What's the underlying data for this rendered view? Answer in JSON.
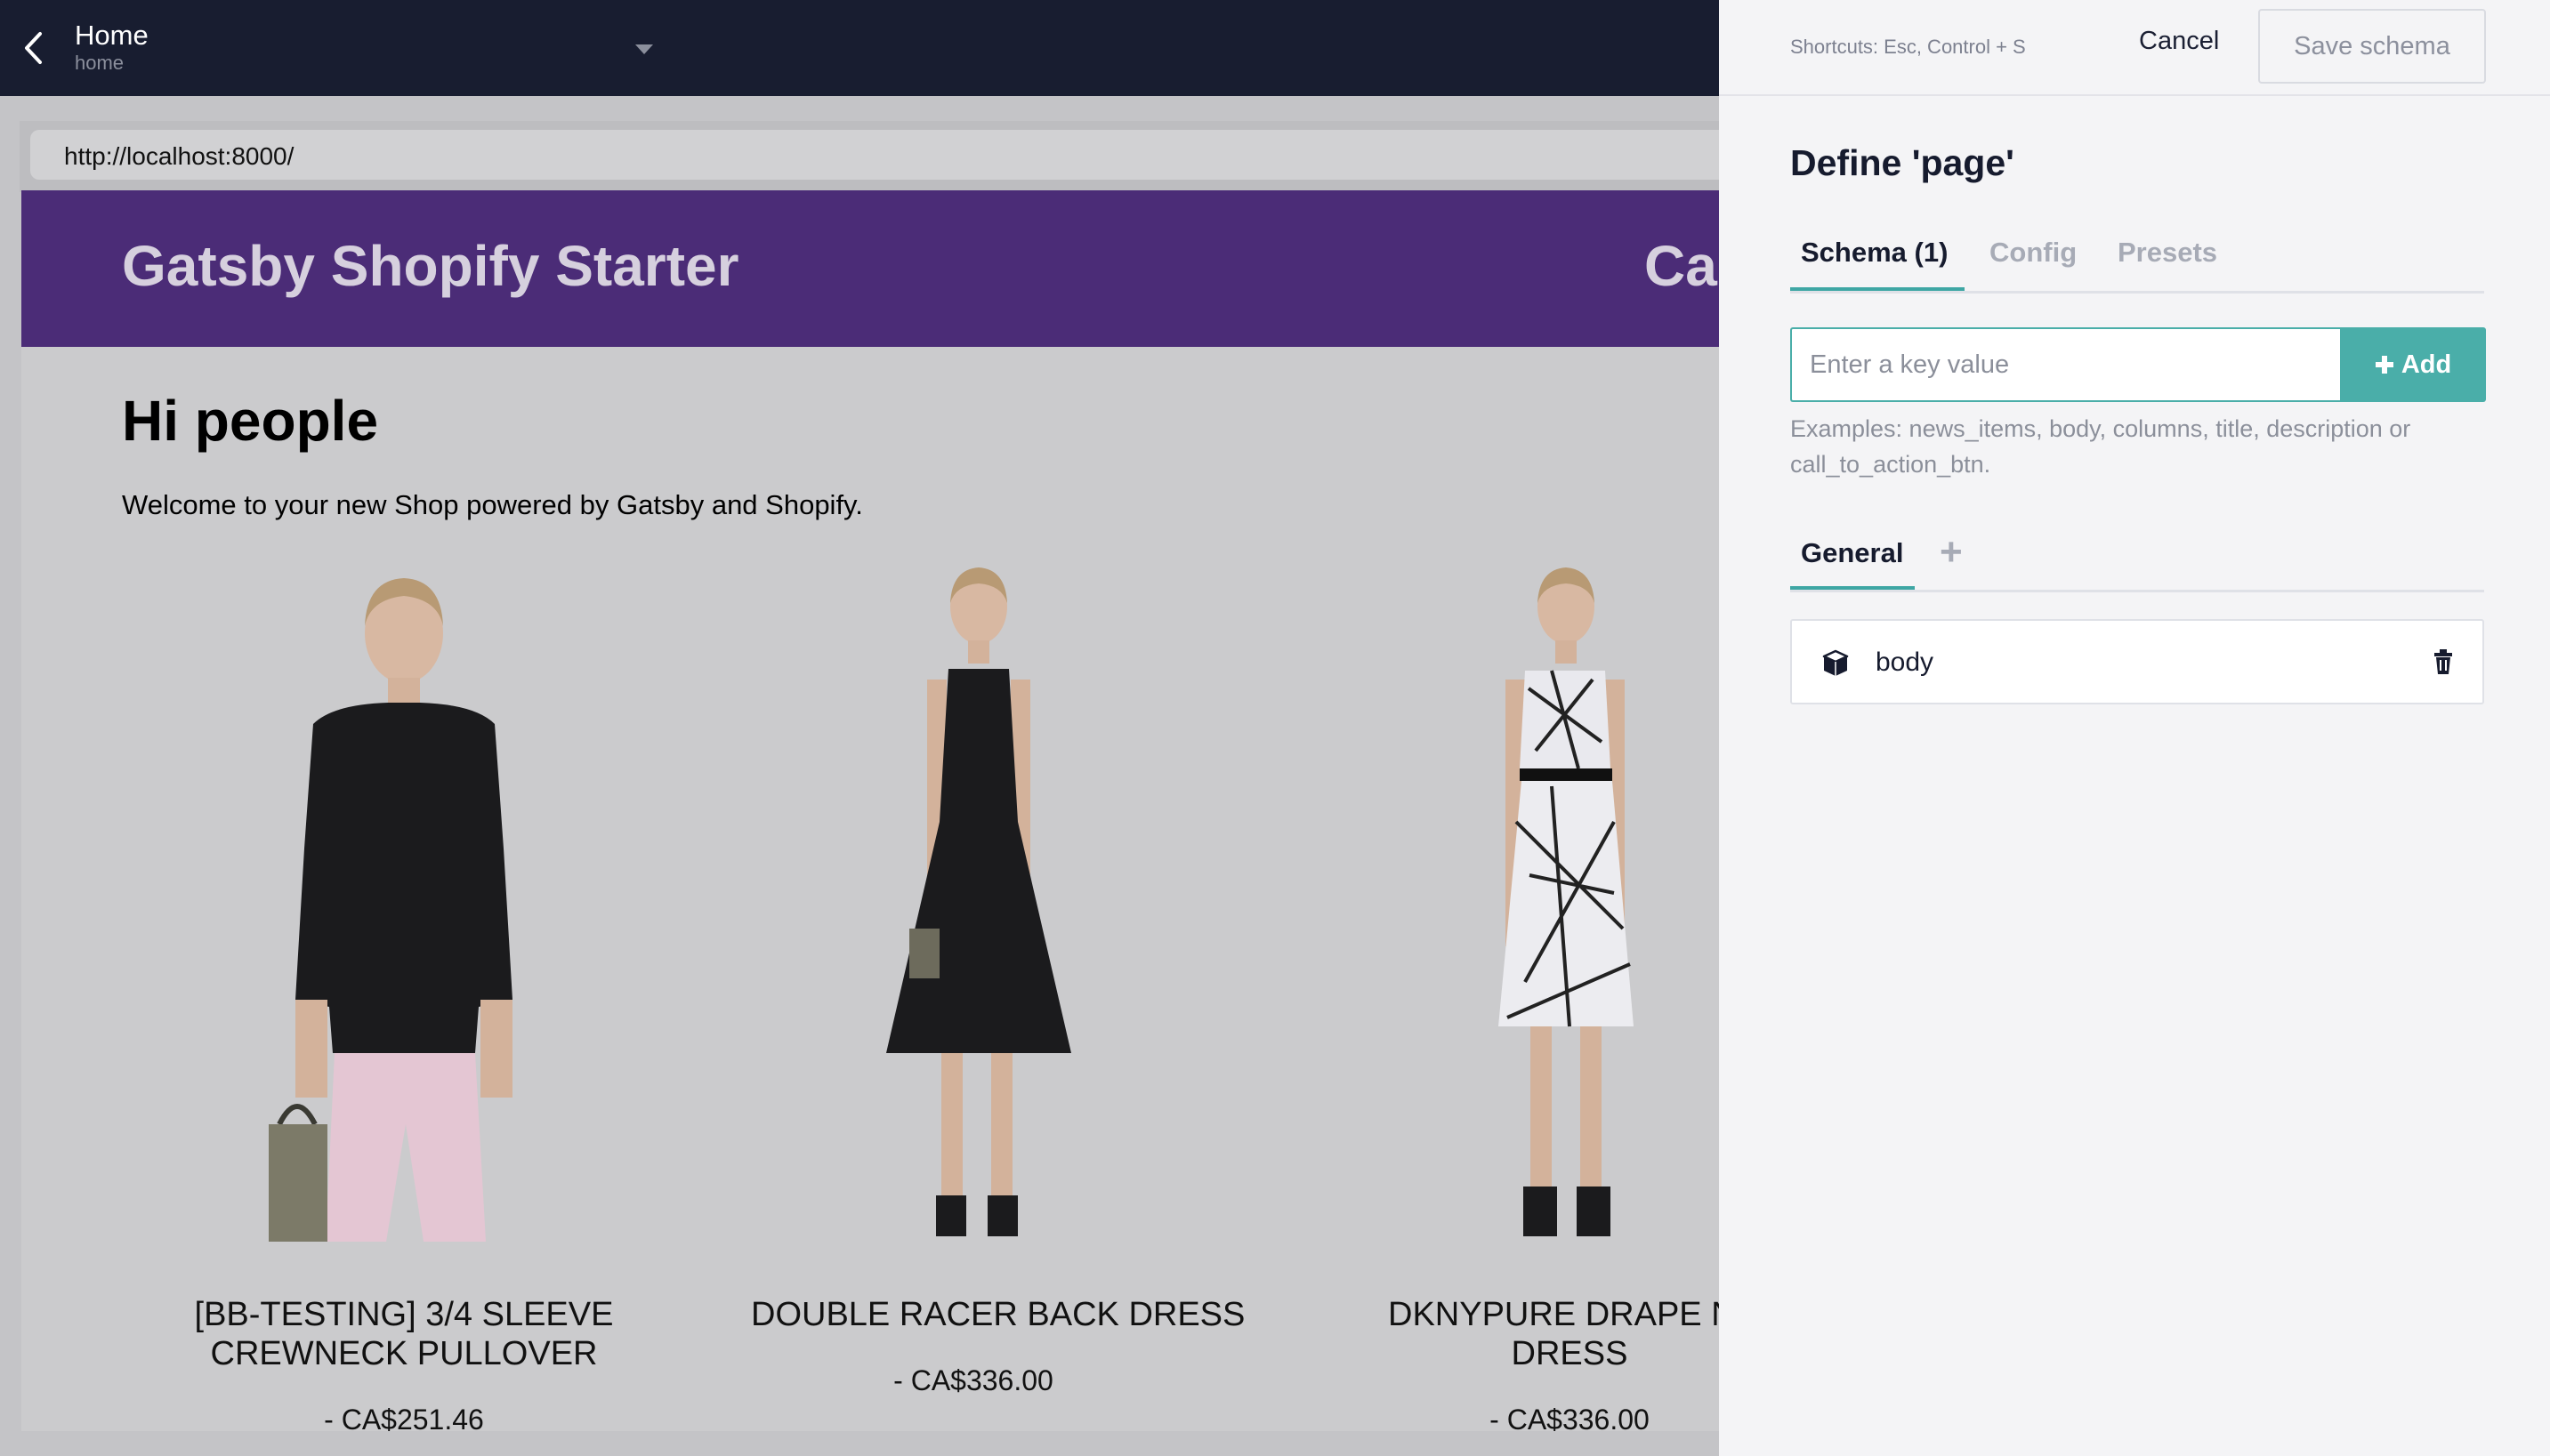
{
  "topbar": {
    "title": "Home",
    "subtitle": "home"
  },
  "preview": {
    "url": "http://localhost:8000/",
    "site_title": "Gatsby Shopify Starter",
    "site_cart_partial": "Ca",
    "heading": "Hi people",
    "welcome": "Welcome to your new Shop powered by Gatsby and Shopify.",
    "products": [
      {
        "name_line1": "[BB-TESTING] 3/4 SLEEVE",
        "name_line2": "CREWNECK PULLOVER",
        "price": "- CA$251.46"
      },
      {
        "name_line1": "DOUBLE RACER BACK DRESS",
        "name_line2": "",
        "price": "- CA$336.00"
      },
      {
        "name_line1": "DKNYPURE DRAPE NE",
        "name_line2": "DRESS",
        "price": "- CA$336.00"
      }
    ]
  },
  "panel": {
    "shortcuts": "Shortcuts: Esc, Control + S",
    "cancel_label": "Cancel",
    "save_label": "Save schema",
    "title": "Define 'page'",
    "tabs": [
      {
        "label": "Schema (1)",
        "active": true
      },
      {
        "label": "Config",
        "active": false
      },
      {
        "label": "Presets",
        "active": false
      }
    ],
    "key_input_placeholder": "Enter a key value",
    "add_label": "Add",
    "examples": "Examples: news_items, body, columns, title, description or call_to_action_btn.",
    "group_tab": "General",
    "fields": [
      {
        "label": "body",
        "icon": "cube-icon"
      }
    ]
  },
  "colors": {
    "topbar_bg": "#181d30",
    "site_header_bg": "#4b2c77",
    "accent": "#4aaea9"
  }
}
